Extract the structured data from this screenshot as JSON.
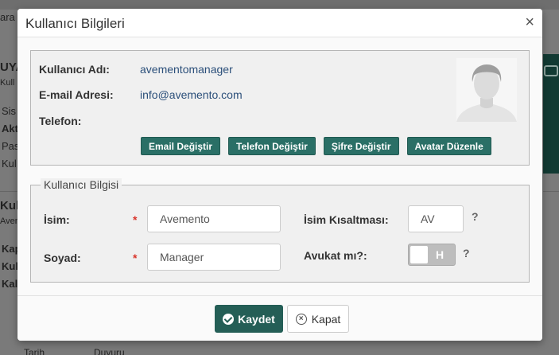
{
  "background": {
    "top_left": "ara",
    "brand_fragment": "UYA",
    "sub_fragment": "Kull",
    "menu_items": [
      "Sis",
      "Akt",
      "Pas",
      "Kul"
    ],
    "second_title": "Kul",
    "second_sub": "Aven",
    "second_items": [
      "Kap",
      "Kul",
      "Kal"
    ],
    "footer_cols": [
      "Tarih",
      "Duyuru"
    ]
  },
  "modal": {
    "title": "Kullanıcı Bilgileri",
    "close_glyph": "×"
  },
  "user_info": {
    "username_label": "Kullanıcı Adı:",
    "username_value": "avementomanager",
    "email_label": "E-mail Adresi:",
    "email_value": "info@avemento.com",
    "phone_label": "Telefon:",
    "phone_value": "",
    "avatar_icon": "user-avatar-placeholder"
  },
  "actions": {
    "email": "Email Değiştir",
    "phone": "Telefon Değiştir",
    "password": "Şifre Değiştir",
    "avatar": "Avatar Düzenle"
  },
  "form": {
    "legend": "Kullanıcı Bilgisi",
    "first_name_label": "İsim:",
    "first_name_value": "Avemento",
    "last_name_label": "Soyad:",
    "last_name_value": "Manager",
    "required_mark": "*",
    "initials_label": "İsim Kısaltması:",
    "initials_value": "AV",
    "lawyer_label": "Avukat mı?:",
    "lawyer_toggle_text": "H",
    "help_glyph": "?"
  },
  "footer": {
    "save_label": "Kaydet",
    "close_label": "Kapat"
  },
  "colors": {
    "accent": "#245e56",
    "link": "#2b4f7a",
    "required": "#d9342b"
  }
}
